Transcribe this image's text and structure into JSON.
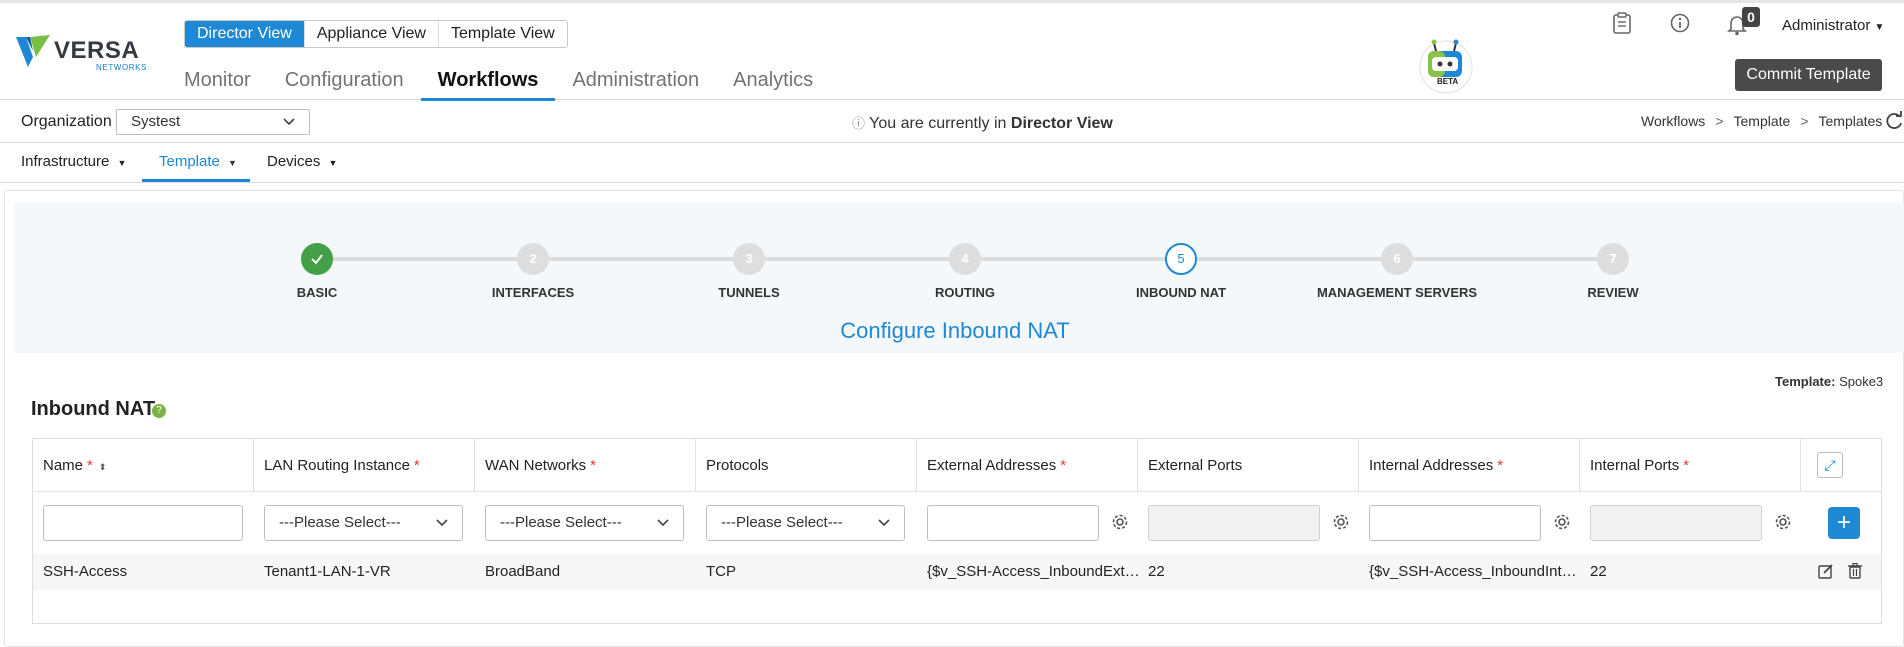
{
  "brand": {
    "name": "VERSA",
    "sub": "NETWORKS"
  },
  "view_switch": [
    "Director View",
    "Appliance View",
    "Template View"
  ],
  "main_nav": [
    "Monitor",
    "Configuration",
    "Workflows",
    "Administration",
    "Analytics"
  ],
  "robot": {
    "badge": "BETA"
  },
  "notifications": {
    "count": "0"
  },
  "user": {
    "name": "Administrator"
  },
  "commit_label": "Commit Template",
  "org": {
    "label": "Organization",
    "value": "Systest"
  },
  "current_view": {
    "prefix": "You are currently in",
    "value": "Director View"
  },
  "breadcrumb": [
    "Workflows",
    "Template",
    "Templates"
  ],
  "sub_nav": [
    "Infrastructure",
    "Template",
    "Devices"
  ],
  "wizard": {
    "steps": [
      {
        "num": "✓",
        "label": "BASIC"
      },
      {
        "num": "2",
        "label": "INTERFACES"
      },
      {
        "num": "3",
        "label": "TUNNELS"
      },
      {
        "num": "4",
        "label": "ROUTING"
      },
      {
        "num": "5",
        "label": "INBOUND NAT"
      },
      {
        "num": "6",
        "label": "MANAGEMENT SERVERS"
      },
      {
        "num": "7",
        "label": "REVIEW"
      }
    ],
    "title": "Configure Inbound NAT"
  },
  "template_note": {
    "label": "Template:",
    "value": "Spoke3"
  },
  "section_title": "Inbound NAT",
  "table": {
    "headers": [
      "Name",
      "LAN Routing Instance",
      "WAN Networks",
      "Protocols",
      "External Addresses",
      "External Ports",
      "Internal Addresses",
      "Internal Ports"
    ],
    "select_placeholder": "---Please Select---",
    "row": [
      "SSH-Access",
      "Tenant1-LAN-1-VR",
      "BroadBand",
      "TCP",
      "{$v_SSH-Access_InboundExt…",
      "22",
      "{$v_SSH-Access_InboundInt…",
      "22"
    ]
  },
  "colors": {
    "accent": "#1e88d4",
    "done": "#43a047",
    "required": "#e53935"
  }
}
